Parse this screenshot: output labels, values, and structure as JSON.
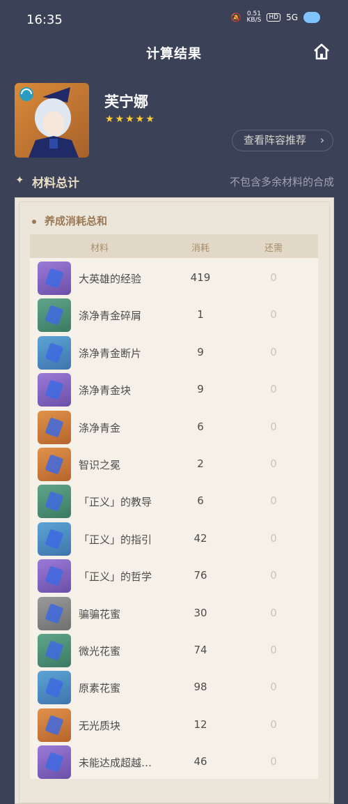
{
  "status": {
    "time": "16:35",
    "speed": "0.51",
    "speed_unit": "KB/S",
    "hd": "HD",
    "net": "5G"
  },
  "header": {
    "title": "计算结果"
  },
  "character": {
    "name": "芙宁娜",
    "stars": "★★★★★"
  },
  "team_button": {
    "label": "查看阵容推荐",
    "chevron": "›"
  },
  "section": {
    "spark": "✦",
    "title": "材料总计",
    "note": "不包含多余材料的合成"
  },
  "panel": {
    "subtitle": "养成消耗总和"
  },
  "table": {
    "headers": {
      "name": "材料",
      "use": "消耗",
      "need": "还需"
    },
    "rows": [
      {
        "name": "大英雄的经验",
        "use": "419",
        "need": "0",
        "color": "purple"
      },
      {
        "name": "涤净青金碎屑",
        "use": "1",
        "need": "0",
        "color": "green"
      },
      {
        "name": "涤净青金断片",
        "use": "9",
        "need": "0",
        "color": "blue"
      },
      {
        "name": "涤净青金块",
        "use": "9",
        "need": "0",
        "color": "purple"
      },
      {
        "name": "涤净青金",
        "use": "6",
        "need": "0",
        "color": "orange"
      },
      {
        "name": "智识之冕",
        "use": "2",
        "need": "0",
        "color": "orange"
      },
      {
        "name": "「正义」的教导",
        "use": "6",
        "need": "0",
        "color": "green"
      },
      {
        "name": "「正义」的指引",
        "use": "42",
        "need": "0",
        "color": "blue"
      },
      {
        "name": "「正义」的哲学",
        "use": "76",
        "need": "0",
        "color": "purple"
      },
      {
        "name": "骗骗花蜜",
        "use": "30",
        "need": "0",
        "color": "grey"
      },
      {
        "name": "微光花蜜",
        "use": "74",
        "need": "0",
        "color": "green"
      },
      {
        "name": "原素花蜜",
        "use": "98",
        "need": "0",
        "color": "blue"
      },
      {
        "name": "无光质块",
        "use": "12",
        "need": "0",
        "color": "orange"
      },
      {
        "name": "未能达成超越…",
        "use": "46",
        "need": "0",
        "color": "purple"
      }
    ]
  }
}
